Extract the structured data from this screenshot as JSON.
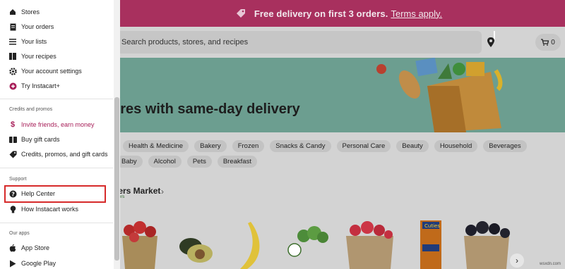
{
  "promo": {
    "text": "Free delivery on first 3 orders.",
    "link": "Terms apply."
  },
  "search": {
    "placeholder": "Search products, stores, and recipes"
  },
  "cart": {
    "count": "0"
  },
  "hero": {
    "title": "ores with same-day delivery"
  },
  "chips": {
    "row1": [
      "Health & Medicine",
      "Bakery",
      "Frozen",
      "Snacks & Candy",
      "Personal Care",
      "Beauty",
      "Household",
      "Beverages"
    ],
    "row2": [
      "Baby",
      "Alcohol",
      "Pets",
      "Breakfast"
    ]
  },
  "store": {
    "title": "ners Market",
    "subtitle": "ers",
    "chevron": "›"
  },
  "menu": {
    "items_top": [
      "Stores",
      "Your orders",
      "Your lists",
      "Your recipes",
      "Your account settings",
      "Try Instacart+"
    ],
    "credits_header": "Credits and promos",
    "credits": [
      "Invite friends, earn money",
      "Buy gift cards",
      "Credits, promos, and gift cards"
    ],
    "support_header": "Support",
    "support": [
      "Help Center",
      "How Instacart works"
    ],
    "apps_header": "Our apps",
    "apps": [
      "App Store",
      "Google Play"
    ]
  },
  "watermark": "wsxdn.com",
  "colors": {
    "promo_bg": "#a8305e",
    "accent": "#a8205a",
    "highlight": "#d62a2a",
    "hero_bg": "#6c9e90"
  }
}
